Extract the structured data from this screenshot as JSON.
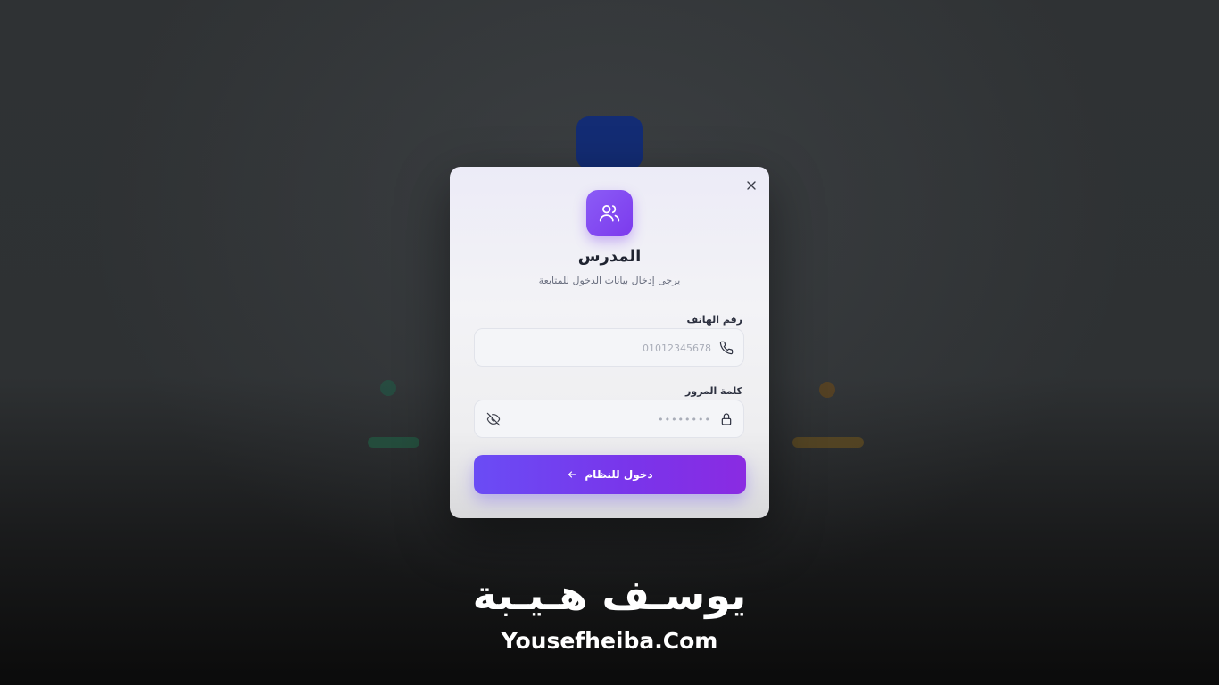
{
  "modal": {
    "title": "المدرس",
    "subtitle": "يرجى إدخال بيانات الدخول للمتابعة",
    "icons": {
      "avatar": "users-icon",
      "close": "close-icon"
    },
    "colors": {
      "accent_start": "#6a4cf5",
      "accent_end": "#8a2be2"
    }
  },
  "form": {
    "phone": {
      "label": "رقم الهاتف",
      "placeholder": "01012345678",
      "value": "",
      "icon": "phone-icon"
    },
    "password": {
      "label": "كلمة المرور",
      "placeholder": "••••••••",
      "value": "",
      "icon": "lock-icon",
      "toggle_icon": "eye-off-icon"
    },
    "submit": {
      "label": "دخول للنظام",
      "icon": "arrow-left-icon"
    }
  },
  "watermark": {
    "arabic": "يوسـف هـيـبة",
    "latin": "Yousefheiba.Com"
  }
}
